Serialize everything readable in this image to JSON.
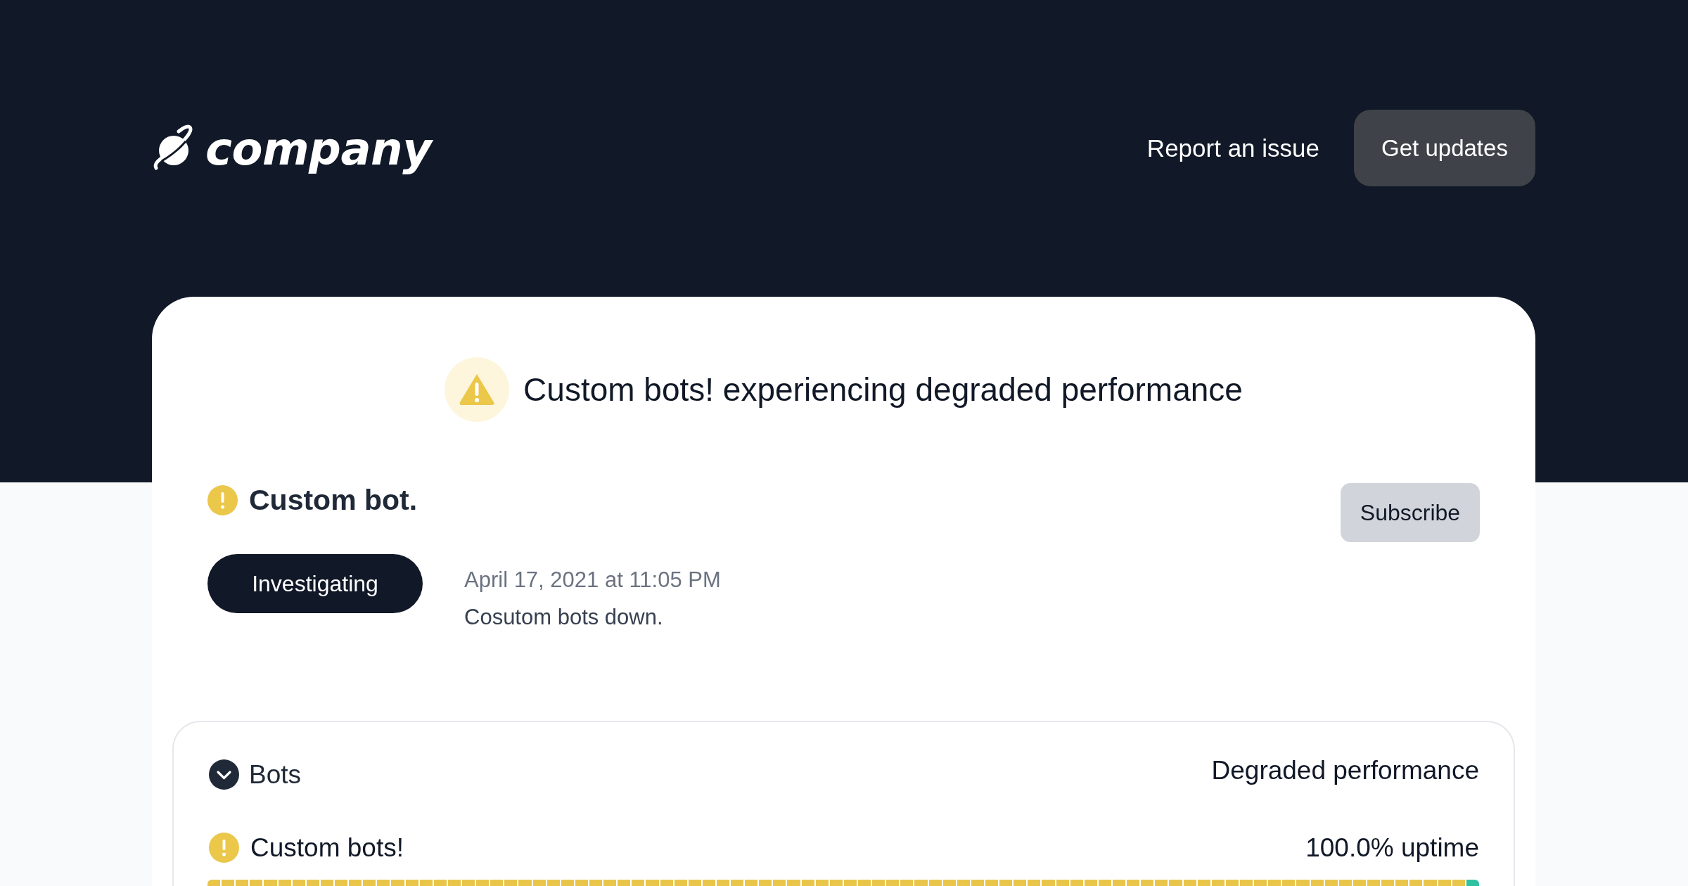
{
  "header": {
    "logo_text": "company",
    "report_link": "Report an issue",
    "updates_button": "Get updates"
  },
  "banner": {
    "kind": "warning",
    "title": "Custom bots! experiencing degraded performance"
  },
  "incident": {
    "kind": "warning",
    "title": "Custom bot.",
    "subscribe_button": "Subscribe",
    "updates": [
      {
        "stage": "Investigating",
        "time": "April 17, 2021 at 11:05 PM",
        "message": "Cosutom bots down."
      }
    ]
  },
  "components": [
    {
      "name": "Bots",
      "expanded": true,
      "status_text": "Degraded performance",
      "children": [
        {
          "name": "Custom bots!",
          "kind": "warning",
          "uptime": "100.0% uptime",
          "days": [
            {
              "color": "#e9c54a"
            },
            {
              "color": "#e9c54a"
            },
            {
              "color": "#e9c54a"
            },
            {
              "color": "#e9c54a"
            },
            {
              "color": "#e9c54a"
            },
            {
              "color": "#e9c54a"
            },
            {
              "color": "#e9c54a"
            },
            {
              "color": "#e9c54a"
            },
            {
              "color": "#e9c54a"
            },
            {
              "color": "#e9c54a"
            },
            {
              "color": "#e9c54a"
            },
            {
              "color": "#e9c54a"
            },
            {
              "color": "#e9c54a"
            },
            {
              "color": "#e9c54a"
            },
            {
              "color": "#e9c54a"
            },
            {
              "color": "#e9c54a"
            },
            {
              "color": "#e9c54a"
            },
            {
              "color": "#e9c54a"
            },
            {
              "color": "#e9c54a"
            },
            {
              "color": "#e9c54a"
            },
            {
              "color": "#e9c54a"
            },
            {
              "color": "#e9c54a"
            },
            {
              "color": "#e9c54a"
            },
            {
              "color": "#e9c54a"
            },
            {
              "color": "#e9c54a"
            },
            {
              "color": "#e9c54a"
            },
            {
              "color": "#e9c54a"
            },
            {
              "color": "#e9c54a"
            },
            {
              "color": "#e9c54a"
            },
            {
              "color": "#e9c54a"
            },
            {
              "color": "#e9c54a"
            },
            {
              "color": "#e9c54a"
            },
            {
              "color": "#e9c54a"
            },
            {
              "color": "#e9c54a"
            },
            {
              "color": "#e9c54a"
            },
            {
              "color": "#e9c54a"
            },
            {
              "color": "#e9c54a"
            },
            {
              "color": "#e9c54a"
            },
            {
              "color": "#e9c54a"
            },
            {
              "color": "#e9c54a"
            },
            {
              "color": "#e9c54a"
            },
            {
              "color": "#e9c54a"
            },
            {
              "color": "#e9c54a"
            },
            {
              "color": "#e9c54a"
            },
            {
              "color": "#e9c54a"
            },
            {
              "color": "#e9c54a"
            },
            {
              "color": "#e9c54a"
            },
            {
              "color": "#e9c54a"
            },
            {
              "color": "#e9c54a"
            },
            {
              "color": "#e9c54a"
            },
            {
              "color": "#e9c54a"
            },
            {
              "color": "#e9c54a"
            },
            {
              "color": "#e9c54a"
            },
            {
              "color": "#e9c54a"
            },
            {
              "color": "#e9c54a"
            },
            {
              "color": "#e9c54a"
            },
            {
              "color": "#e9c54a"
            },
            {
              "color": "#e9c54a"
            },
            {
              "color": "#e9c54a"
            },
            {
              "color": "#e9c54a"
            },
            {
              "color": "#e9c54a"
            },
            {
              "color": "#e9c54a"
            },
            {
              "color": "#e9c54a"
            },
            {
              "color": "#e9c54a"
            },
            {
              "color": "#e9c54a"
            },
            {
              "color": "#e9c54a"
            },
            {
              "color": "#e9c54a"
            },
            {
              "color": "#e9c54a"
            },
            {
              "color": "#e9c54a"
            },
            {
              "color": "#e9c54a"
            },
            {
              "color": "#e9c54a"
            },
            {
              "color": "#e9c54a"
            },
            {
              "color": "#e9c54a"
            },
            {
              "color": "#e9c54a"
            },
            {
              "color": "#e9c54a"
            },
            {
              "color": "#e9c54a"
            },
            {
              "color": "#e9c54a"
            },
            {
              "color": "#e9c54a"
            },
            {
              "color": "#e9c54a"
            },
            {
              "color": "#e9c54a"
            },
            {
              "color": "#e9c54a"
            },
            {
              "color": "#e9c54a"
            },
            {
              "color": "#e9c54a"
            },
            {
              "color": "#e9c54a"
            },
            {
              "color": "#e9c54a"
            },
            {
              "color": "#e9c54a"
            },
            {
              "color": "#e9c54a"
            },
            {
              "color": "#e9c54a"
            },
            {
              "color": "#e9c54a"
            },
            {
              "color": "#2fc1a1"
            }
          ]
        }
      ]
    }
  ]
}
